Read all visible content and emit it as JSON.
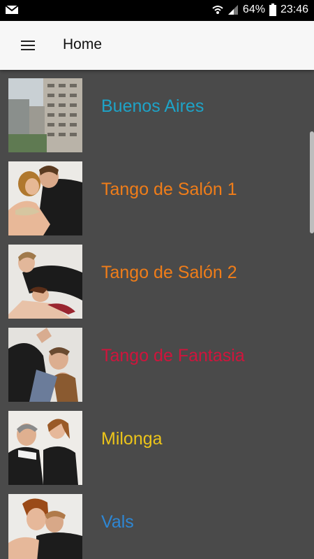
{
  "status_bar": {
    "battery": "64%",
    "time": "23:46"
  },
  "app_bar": {
    "title": "Home"
  },
  "list": [
    {
      "label": "Buenos Aires",
      "color": "#1ea3c7"
    },
    {
      "label": "Tango de Salón 1",
      "color": "#f07d19"
    },
    {
      "label": "Tango de Salón 2",
      "color": "#f07d19"
    },
    {
      "label": "Tango de Fantasia",
      "color": "#d0143c"
    },
    {
      "label": "Milonga",
      "color": "#ecc41a"
    },
    {
      "label": "Vals",
      "color": "#2e87d4"
    }
  ]
}
